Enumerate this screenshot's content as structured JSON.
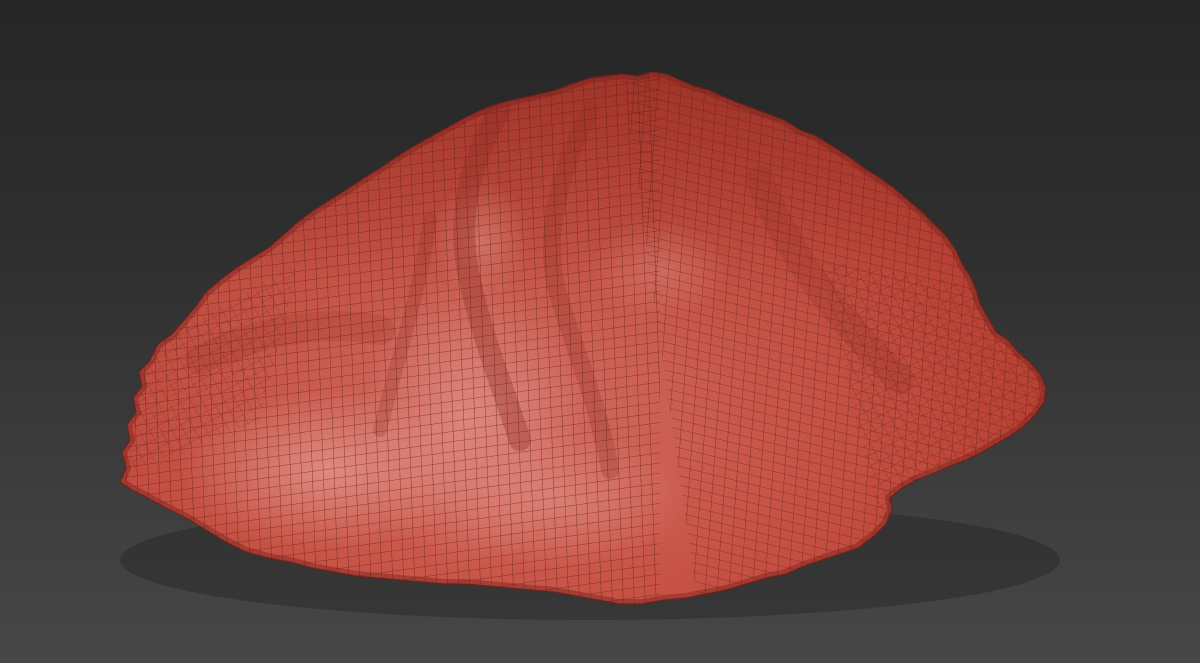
{
  "viewport": {
    "background_top": "#262626",
    "background_bottom": "#474747"
  },
  "mesh": {
    "object": "rock-pile-mesh",
    "display_mode": "wireframe-on-shaded",
    "surface_color": "#c4483a",
    "highlight_color": "#dc7a6e",
    "shadow_color": "#8e2e24",
    "wire_color": "#5a1a14"
  }
}
